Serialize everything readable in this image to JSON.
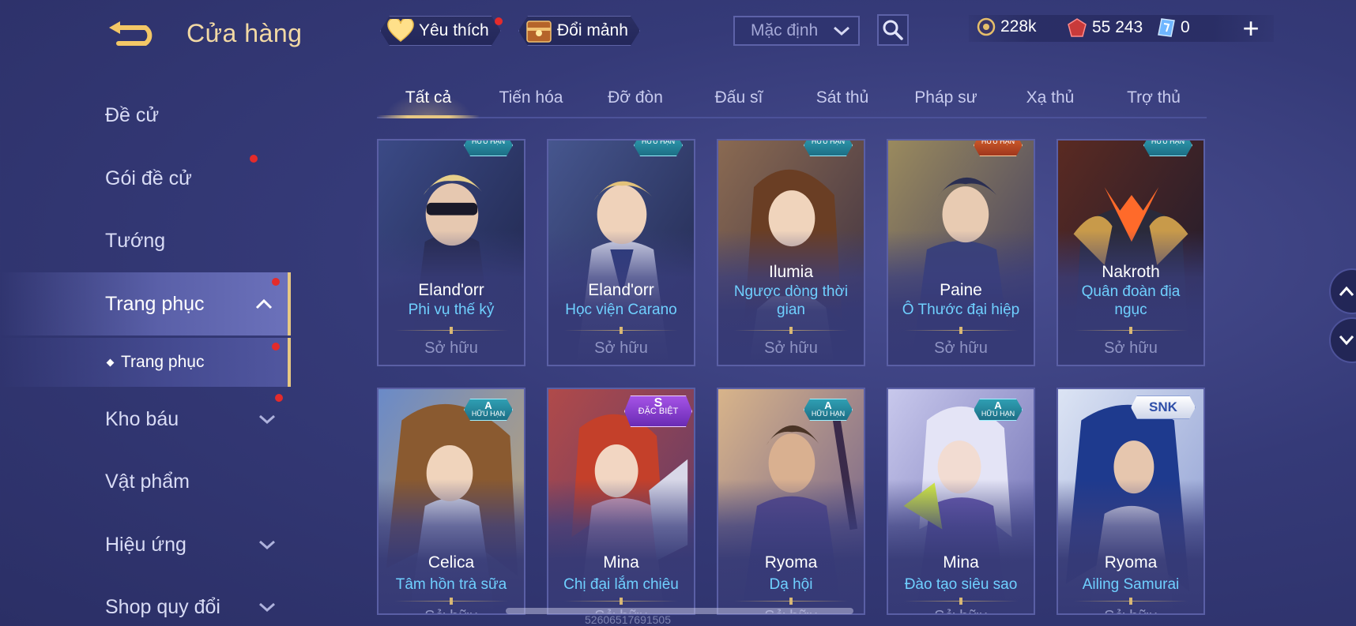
{
  "header": {
    "title": "Cửa hàng",
    "favorites_label": "Yêu thích",
    "exchange_label": "Đổi mảnh",
    "sort_value": "Mặc định"
  },
  "currency": {
    "gold": "228k",
    "vouchers": "55 243",
    "tickets": "0"
  },
  "sidebar": {
    "items": [
      {
        "label": "Đề cử"
      },
      {
        "label": "Gói đề cử"
      },
      {
        "label": "Tướng"
      },
      {
        "label": "Trang phục"
      },
      {
        "label": "Trang phục"
      },
      {
        "label": "Kho báu"
      },
      {
        "label": "Vật phẩm"
      },
      {
        "label": "Hiệu ứng"
      },
      {
        "label": "Shop quy đổi"
      }
    ]
  },
  "tabs": [
    {
      "label": "Tất cả"
    },
    {
      "label": "Tiến hóa"
    },
    {
      "label": "Đỡ đòn"
    },
    {
      "label": "Đấu sĩ"
    },
    {
      "label": "Sát thủ"
    },
    {
      "label": "Pháp sư"
    },
    {
      "label": "Xạ thủ"
    },
    {
      "label": "Trợ thủ"
    }
  ],
  "cards": [
    {
      "hero": "Eland'orr",
      "skin": "Phi vụ thế kỷ",
      "skin2": "",
      "status": "Sở hữu",
      "badge": "HỮU HẠN",
      "tier": ""
    },
    {
      "hero": "Eland'orr",
      "skin": "Học viện Carano",
      "skin2": "",
      "status": "Sở hữu",
      "badge": "HỮU HẠN",
      "tier": ""
    },
    {
      "hero": "Ilumia",
      "skin": "Ngược dòng thời",
      "skin2": "gian",
      "status": "Sở hữu",
      "badge": "HỮU HẠN",
      "tier": ""
    },
    {
      "hero": "Paine",
      "skin": "Ô Thước đại hiệp",
      "skin2": "",
      "status": "Sở hữu",
      "badge": "HỮU HẠN",
      "tier": ""
    },
    {
      "hero": "Nakroth",
      "skin": "Quân đoàn địa",
      "skin2": "ngục",
      "status": "Sở hữu",
      "badge": "HỮU HẠN",
      "tier": ""
    },
    {
      "hero": "Celica",
      "skin": "Tâm hồn trà sữa",
      "skin2": "",
      "status": "Sở hữu",
      "badge": "HỮU HẠN",
      "tier": "A"
    },
    {
      "hero": "Mina",
      "skin": "Chị đại lắm chiêu",
      "skin2": "",
      "status": "Sở hữu",
      "badge": "ĐẶC BIỆT",
      "tier": "S"
    },
    {
      "hero": "Ryoma",
      "skin": "Dạ hội",
      "skin2": "",
      "status": "Sở hữu",
      "badge": "HỮU HẠN",
      "tier": "A"
    },
    {
      "hero": "Mina",
      "skin": "Đào tạo siêu sao",
      "skin2": "",
      "status": "Sở hữu",
      "badge": "HỮU HẠN",
      "tier": "A"
    },
    {
      "hero": "Ryoma",
      "skin": "Ailing Samurai",
      "skin2": "",
      "status": "Sở hữu",
      "badge": "SNK",
      "tier": ""
    }
  ],
  "footer_id": "52606517691505",
  "colors": {
    "accent_gold": "#e7c883",
    "skin_name": "#6fd0ff",
    "notification": "#e42b2b"
  },
  "icons": {
    "back": "back-arrow-icon",
    "favorite": "heart-icon",
    "exchange": "chest-icon",
    "search": "search-icon",
    "gold": "gold-coin-icon",
    "voucher": "red-gem-icon",
    "ticket": "ticket-icon",
    "add": "plus-icon"
  }
}
